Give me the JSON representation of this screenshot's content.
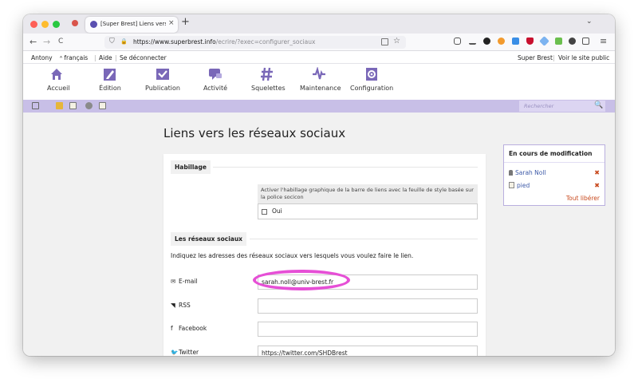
{
  "browser": {
    "tab_title": "[Super Brest] Liens vers les rés",
    "tab_close": "×",
    "new_tab": "+",
    "tab_menu": "⌄",
    "url_host": "https://www.superbrest.info",
    "url_path": "/ecrire/?exec=configurer_sociaux",
    "nav_back": "←",
    "nav_forward": "→",
    "nav_reload": "C",
    "shield": "⛉",
    "lock": "🔒",
    "bookmark": "☆",
    "menu": "≡"
  },
  "topbar": {
    "user": "Antony",
    "language": "français",
    "help": "Aide",
    "logout": "Se déconnecter",
    "site_name": "Super Brest",
    "view_site": "Voir le site public",
    "separator": "|"
  },
  "main_menu": [
    {
      "label": "Accueil",
      "icon": "home-icon"
    },
    {
      "label": "Édition",
      "icon": "pencil-icon"
    },
    {
      "label": "Publication",
      "icon": "check-icon"
    },
    {
      "label": "Activité",
      "icon": "chat-icon"
    },
    {
      "label": "Squelettes",
      "icon": "hash-icon"
    },
    {
      "label": "Maintenance",
      "icon": "pulse-icon"
    },
    {
      "label": "Configuration",
      "icon": "gear-icon"
    }
  ],
  "toolbar": {
    "search_placeholder": "Rechercher",
    "search_icon": "🔍"
  },
  "page": {
    "title": "Liens vers les réseaux sociaux",
    "section_habillage": "Habillage",
    "help_text": "Activer l'habillage graphique de la barre de liens avec la feuille de style basée sur la police socicon",
    "checkbox_label": "Oui",
    "section_social": "Les réseaux sociaux",
    "intro": "Indiquez les adresses des réseaux sociaux vers lesquels vous voulez faire le lien.",
    "fields": [
      {
        "icon": "✉",
        "label": "E-mail",
        "value": "sarah.noll@univ-brest.fr"
      },
      {
        "icon": "◥",
        "label": "RSS",
        "value": ""
      },
      {
        "icon": "f",
        "label": "Facebook",
        "value": ""
      },
      {
        "icon": "🐦",
        "label": "Twitter",
        "value": "https://twitter.com/SHDBrest"
      }
    ]
  },
  "sidebar": {
    "title": "En cours de modification",
    "items": [
      {
        "label": "Sarah Noll",
        "icon": "user-icon",
        "remove": "✖"
      },
      {
        "label": "pied",
        "icon": "document-icon",
        "remove": "✖"
      }
    ],
    "release_all": "Tout libérer"
  },
  "colors": {
    "accent_purple": "#c8bfe7",
    "menu_icon": "#7a68b8",
    "highlight": "#e64fd6",
    "remove_red": "#c84a1e",
    "link_blue": "#3d5aa8"
  }
}
